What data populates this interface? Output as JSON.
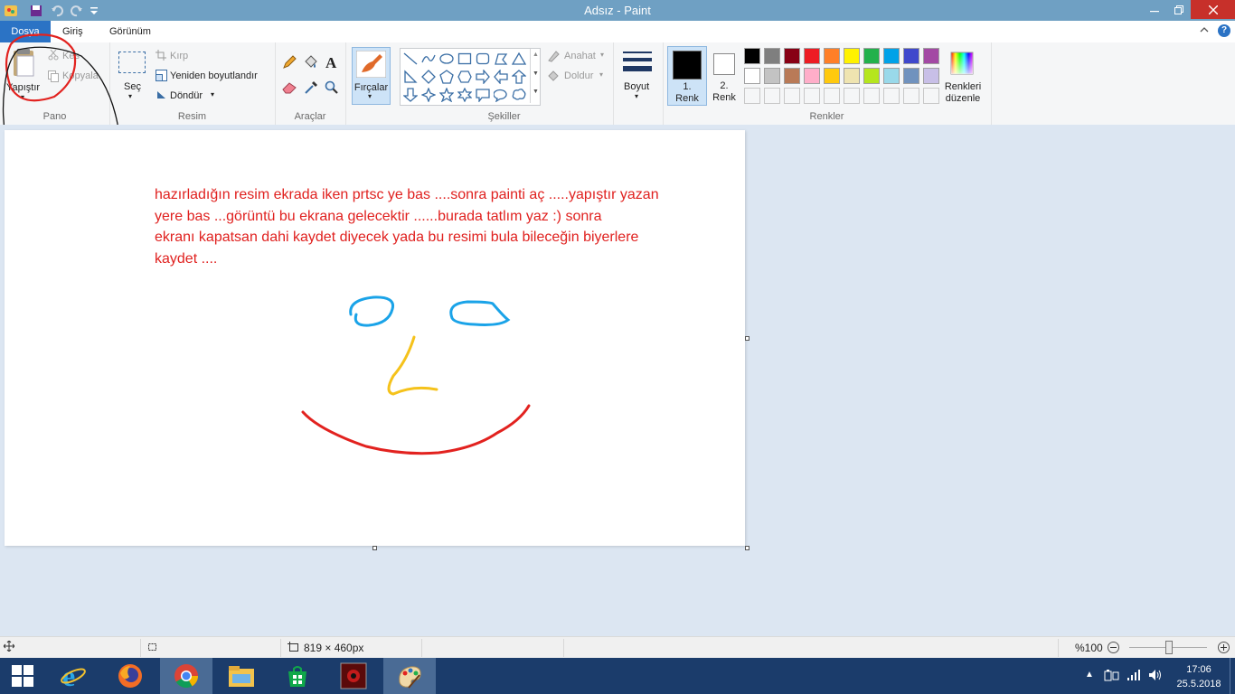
{
  "window": {
    "title": "Adsız - Paint"
  },
  "tabs": {
    "file": "Dosya",
    "home": "Giriş",
    "view": "Görünüm"
  },
  "clipboard": {
    "paste": "Yapıştır",
    "cut": "Kes",
    "copy": "Kopyala",
    "group": "Pano"
  },
  "image": {
    "select": "Seç",
    "crop": "Kırp",
    "resize": "Yeniden boyutlandır",
    "rotate": "Döndür",
    "group": "Resim"
  },
  "tools": {
    "group": "Araçlar"
  },
  "brushes": {
    "label": "Fırçalar"
  },
  "shapes": {
    "outline": "Anahat",
    "fill": "Doldur",
    "group": "Şekiller"
  },
  "size": {
    "label": "Boyut"
  },
  "colors": {
    "color1_num": "1.",
    "color1": "Renk",
    "color2_num": "2.",
    "color2": "Renk",
    "edit_line1": "Renkleri",
    "edit_line2": "düzenle",
    "group": "Renkler",
    "palette_row1": [
      "#000000",
      "#7f7f7f",
      "#880015",
      "#ed1c24",
      "#ff7f27",
      "#fff200",
      "#22b14c",
      "#00a2e8",
      "#3f48cc",
      "#a349a4"
    ],
    "palette_row2": [
      "#ffffff",
      "#c3c3c3",
      "#b97a57",
      "#ffaec9",
      "#ffc90e",
      "#efe4b0",
      "#b5e61d",
      "#99d9ea",
      "#7092be",
      "#c8bfe7"
    ]
  },
  "canvas": {
    "text_line1": "hazırladığın resim ekrada iken prtsc ye bas ....sonra painti  aç  .....yapıştır  yazan",
    "text_line2": "yere bas ...görüntü bu ekrana gelecektir ......burada tatlım yaz   :)  sonra",
    "text_line3": "ekranı kapatsan dahi kaydet diyecek yada  bu resimi bula bileceğin  biyerlere",
    "text_line4": "kaydet ...."
  },
  "status": {
    "dimensions": "819 × 460px",
    "zoom": "%100"
  },
  "tray": {
    "time": "17:06",
    "date": "25.5.2018"
  }
}
